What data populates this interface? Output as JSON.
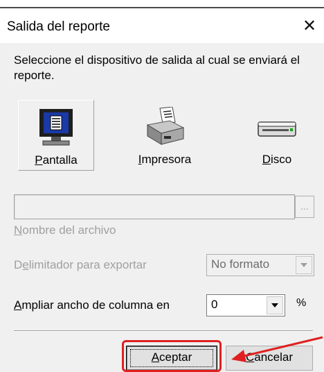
{
  "window": {
    "title": "Salida del reporte",
    "close_glyph": "✕"
  },
  "prompt": "Seleccione el dispositivo de salida al cual se enviará el reporte.",
  "devices": [
    {
      "accesskey": "P",
      "rest": "antalla",
      "icon": "monitor-icon",
      "selected": true
    },
    {
      "accesskey": "I",
      "rest": "mpresora",
      "icon": "printer-icon",
      "selected": false
    },
    {
      "accesskey": "D",
      "rest": "isco",
      "icon": "disk-drive-icon",
      "selected": false
    }
  ],
  "file": {
    "value": "",
    "browse_label": "...",
    "label_accesskey": "N",
    "label_rest": "ombre del archivo"
  },
  "delimiter": {
    "label_accesskey": "e",
    "label_before": "D",
    "label_after": "limitador para exportar",
    "value": "No formato"
  },
  "widen": {
    "label_accesskey": "A",
    "label_rest": "mpliar ancho de columna en",
    "value": "0",
    "unit": "%"
  },
  "buttons": {
    "accept_accesskey": "A",
    "accept_rest": "ceptar",
    "cancel_accesskey": "C",
    "cancel_rest": "ancelar"
  },
  "annotation": {
    "color": "#e02020"
  },
  "colors": {
    "dialog_bg": "#f0f0f0",
    "disabled_text": "#a0a0a0",
    "monitor_screen": "#1a3aa8"
  }
}
